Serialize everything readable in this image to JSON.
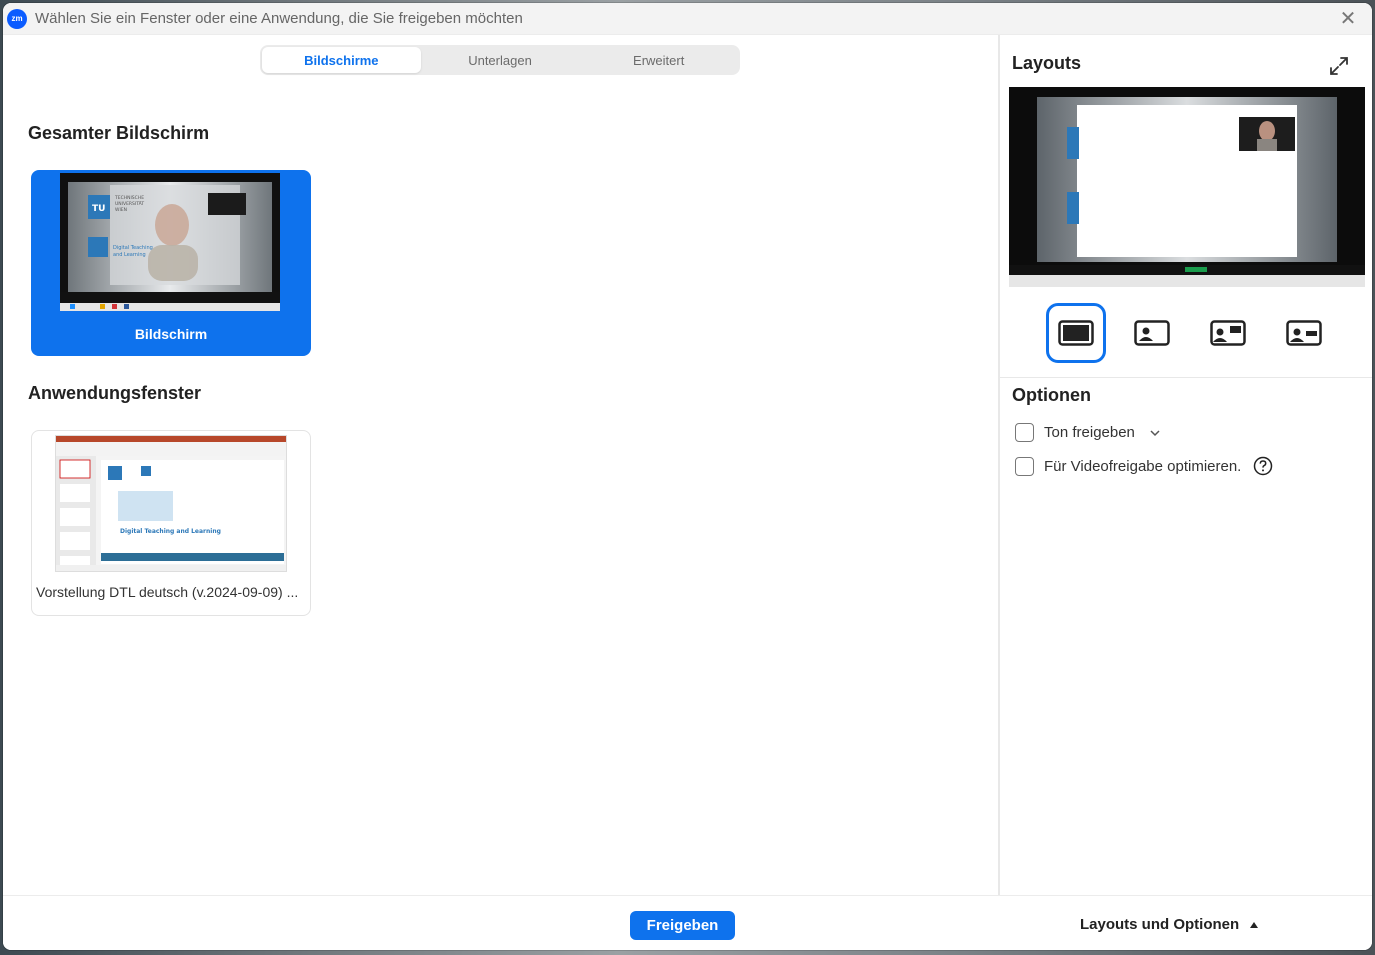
{
  "window": {
    "app_logo": "zm",
    "title": "Wählen Sie ein Fenster oder eine Anwendung, die Sie freigeben möchten",
    "close_icon": "✕"
  },
  "tabs": [
    {
      "label": "Bildschirme",
      "active": true
    },
    {
      "label": "Unterlagen",
      "active": false
    },
    {
      "label": "Erweitert",
      "active": false
    }
  ],
  "sections": {
    "screen_heading": "Gesamter Bildschirm",
    "screen_label": "Bildschirm",
    "apps_heading": "Anwendungsfenster",
    "app_label": "Vorstellung DTL deutsch (v.2024-09-09) ..."
  },
  "thumbs": {
    "tu_logo": "TU",
    "tu_sub": "WIEN",
    "tu_text_1": "TECHNISCHE",
    "tu_text_2": "UNIVERSITÄT",
    "tu_text_3": "WIEN",
    "dtl_text_1": "Digital Teaching",
    "dtl_text_2": "and Learning",
    "slide_title": "Digital Teaching and Learning"
  },
  "right": {
    "layouts_heading": "Layouts",
    "options_heading": "Optionen",
    "options": [
      {
        "label": "Ton freigeben",
        "checked": false
      },
      {
        "label": "Für Videofreigabe optimieren.",
        "checked": false
      }
    ]
  },
  "footer": {
    "share_label": "Freigeben",
    "layouts_toggle_label": "Layouts und Optionen"
  },
  "colors": {
    "accent": "#0e72ed",
    "brand": "#0b5cff"
  },
  "icons": [
    "close-icon",
    "expand-icon",
    "chevron-down-icon",
    "help-icon",
    "caret-up-icon",
    "layout-screen-only-icon",
    "layout-side-video-icon",
    "layout-top-right-video-icon",
    "layout-center-video-icon"
  ]
}
